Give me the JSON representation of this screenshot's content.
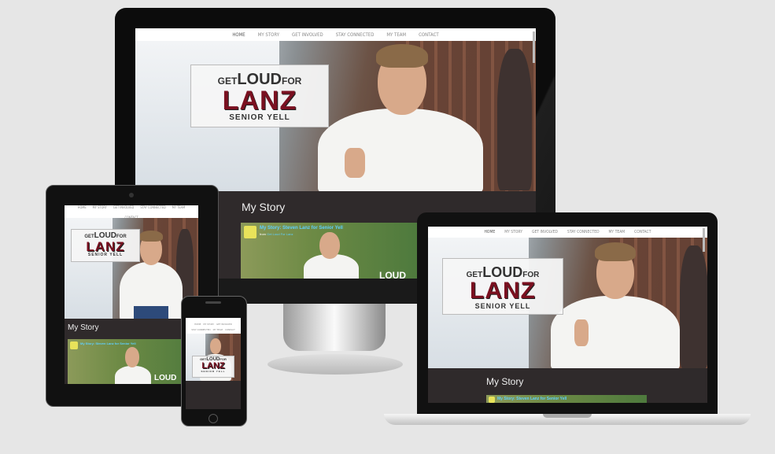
{
  "nav_items": [
    "HOME",
    "MY STORY",
    "GET INVOLVED",
    "STAY CONNECTED",
    "MY TEAM",
    "CONTACT"
  ],
  "logo": {
    "top": "GET LOUD FOR",
    "name": "LANZ",
    "sub": "SENIOR YELL"
  },
  "section_title": "My Story",
  "video": {
    "title": "My Story: Steven Lanz for Senior Yell",
    "from_label": "from",
    "channel": "Get Loud For Lanz",
    "overlay_text": "LOUD"
  },
  "logo_parts": {
    "get": "GET",
    "loud": "LOUD",
    "for": "FOR"
  },
  "colors": {
    "accent": "#7a1020",
    "section_bg": "#2f2a2b",
    "link": "#5fd0ff",
    "page_bg": "#e6e6e6"
  }
}
